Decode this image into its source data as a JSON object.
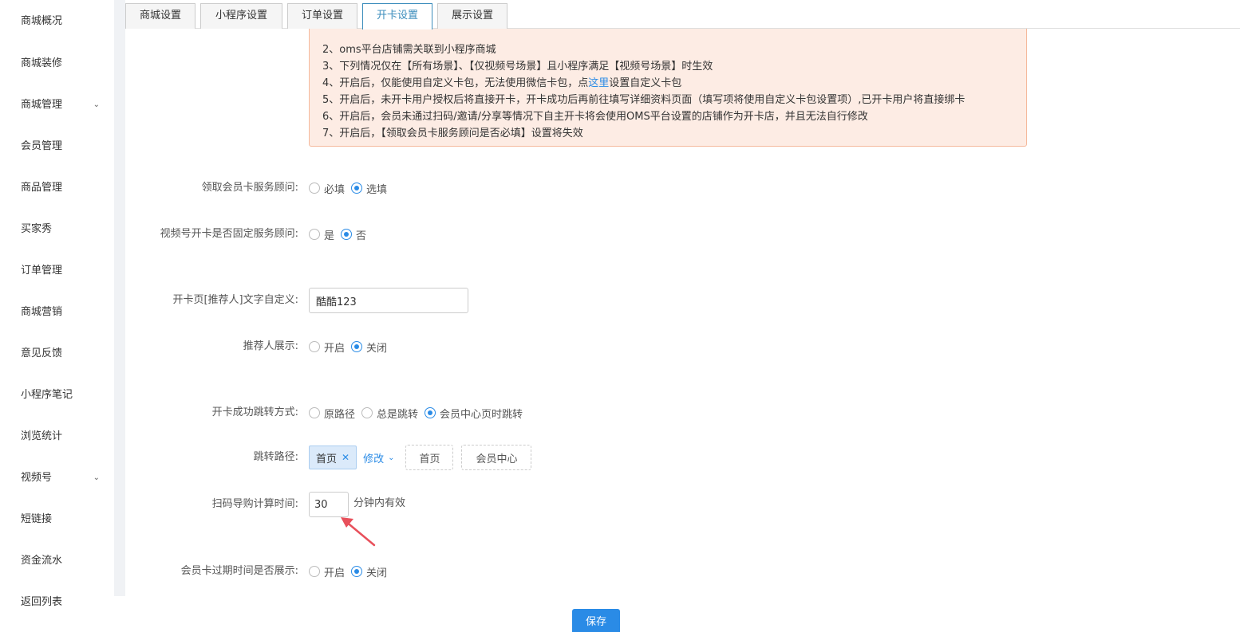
{
  "sidebar": {
    "items": [
      {
        "label": "商城概况",
        "chevron": false
      },
      {
        "label": "商城装修",
        "chevron": false
      },
      {
        "label": "商城管理",
        "chevron": true
      },
      {
        "label": "会员管理",
        "chevron": false
      },
      {
        "label": "商品管理",
        "chevron": false
      },
      {
        "label": "买家秀",
        "chevron": false
      },
      {
        "label": "订单管理",
        "chevron": false
      },
      {
        "label": "商城营销",
        "chevron": false
      },
      {
        "label": "意见反馈",
        "chevron": false
      },
      {
        "label": "小程序笔记",
        "chevron": false
      },
      {
        "label": "浏览统计",
        "chevron": false
      },
      {
        "label": "视频号",
        "chevron": true
      },
      {
        "label": "短链接",
        "chevron": false
      },
      {
        "label": "资金流水",
        "chevron": false
      },
      {
        "label": "返回列表",
        "chevron": false
      }
    ],
    "chevron_glyph": "⌄"
  },
  "tabs": [
    {
      "label": "商城设置",
      "active": false
    },
    {
      "label": "小程序设置",
      "active": false
    },
    {
      "label": "订单设置",
      "active": false
    },
    {
      "label": "开卡设置",
      "active": true
    },
    {
      "label": "展示设置",
      "active": false
    }
  ],
  "notice": {
    "lines": [
      "2、oms平台店铺需关联到小程序商城",
      "3、下列情况仅在【所有场景】、【仅视频号场景】且小程序满足【视频号场景】时生效",
      "4、开启后，仅能使用自定义卡包，无法使用微信卡包，点",
      "5、开启后，未开卡用户授权后将直接开卡，开卡成功后再前往填写详细资料页面（填写项将使用自定义卡包设置项）,已开卡用户将直接绑卡",
      "6、开启后，会员未通过扫码/邀请/分享等情况下自主开卡将会使用OMS平台设置的店铺作为开卡店，并且无法自行修改",
      "7、开启后，【领取会员卡服务顾问是否必填】设置将失效"
    ],
    "line4_link": "这里",
    "line4_suffix": "设置自定义卡包"
  },
  "form": {
    "advisor_required": {
      "label": "领取会员卡服务顾问:",
      "options": [
        "必填",
        "选填"
      ],
      "selected": 1
    },
    "channel_fixed_advisor": {
      "label": "视频号开卡是否固定服务顾问:",
      "options": [
        "是",
        "否"
      ],
      "selected": 1
    },
    "referrer_text": {
      "label": "开卡页[推荐人]文字自定义:",
      "value": "酷酷123"
    },
    "referrer_display": {
      "label": "推荐人展示:",
      "options": [
        "开启",
        "关闭"
      ],
      "selected": 1
    },
    "redirect_mode": {
      "label": "开卡成功跳转方式:",
      "options": [
        "原路径",
        "总是跳转",
        "会员中心页时跳转"
      ],
      "selected": 2
    },
    "redirect_path": {
      "label": "跳转路径:",
      "tag": "首页",
      "tag_close": "✕",
      "modify": "修改",
      "caret": "⌄",
      "shortcuts": [
        "首页",
        "会员中心"
      ]
    },
    "scan_time": {
      "label": "扫码导购计算时间:",
      "value": "30",
      "suffix": "分钟内有效"
    },
    "expiry_display": {
      "label": "会员卡过期时间是否展示:",
      "options": [
        "开启",
        "关闭"
      ],
      "selected": 1
    }
  },
  "footer": {
    "save_label": "保存"
  },
  "colors": {
    "accent": "#2a8be6",
    "notice_bg": "#fdece4",
    "arrow": "#e8505b"
  }
}
